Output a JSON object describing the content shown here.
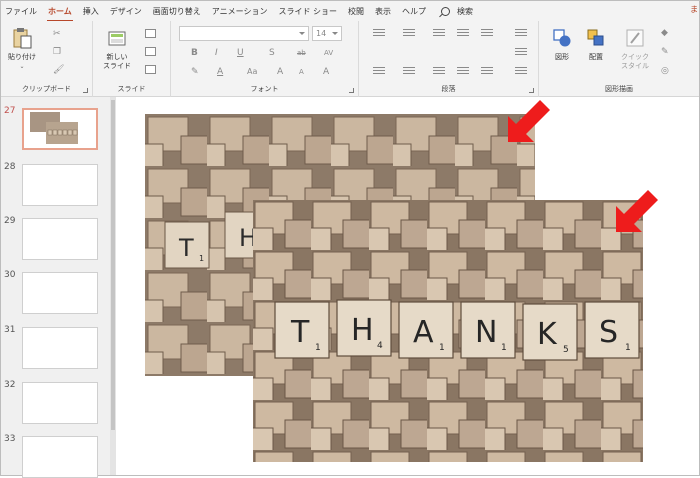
{
  "menu": {
    "tabs": [
      "ファイル",
      "ホーム",
      "挿入",
      "デザイン",
      "画面切り替え",
      "アニメーション",
      "スライド ショー",
      "校閲",
      "表示",
      "ヘルプ"
    ],
    "active": "ホーム",
    "search_label": "検索",
    "right_fragment": "ま"
  },
  "ribbon": {
    "clipboard": {
      "label": "クリップボード",
      "paste_label": "貼り付け"
    },
    "slides": {
      "label": "スライド",
      "new_slide_label": "新しい\nスライド"
    },
    "font": {
      "label": "フォント",
      "font_name": "",
      "font_size": "14"
    },
    "paragraph": {
      "label": "段落"
    },
    "drawing": {
      "label": "図形描画",
      "shape_label": "図形",
      "arrange_label": "配置",
      "quick_style_label": "クイック\nスタイル"
    }
  },
  "slides_panel": {
    "items": [
      {
        "number": "27",
        "selected": true
      },
      {
        "number": "28",
        "selected": false
      },
      {
        "number": "29",
        "selected": false
      },
      {
        "number": "30",
        "selected": false
      },
      {
        "number": "31",
        "selected": false
      },
      {
        "number": "32",
        "selected": false
      },
      {
        "number": "33",
        "selected": false
      }
    ]
  },
  "canvas": {
    "tiles_text": [
      {
        "letter": "T",
        "sub": "1"
      },
      {
        "letter": "H",
        "sub": "4"
      },
      {
        "letter": "A",
        "sub": "1"
      },
      {
        "letter": "N",
        "sub": "1"
      },
      {
        "letter": "K",
        "sub": "5"
      },
      {
        "letter": "S",
        "sub": "1"
      }
    ],
    "arrow_color": "#ee1c1c"
  },
  "colors": {
    "accent": "#b7472a",
    "selection": "#e8a28d",
    "wood_light": "#cdb9a2",
    "wood_dark": "#8a7563"
  }
}
